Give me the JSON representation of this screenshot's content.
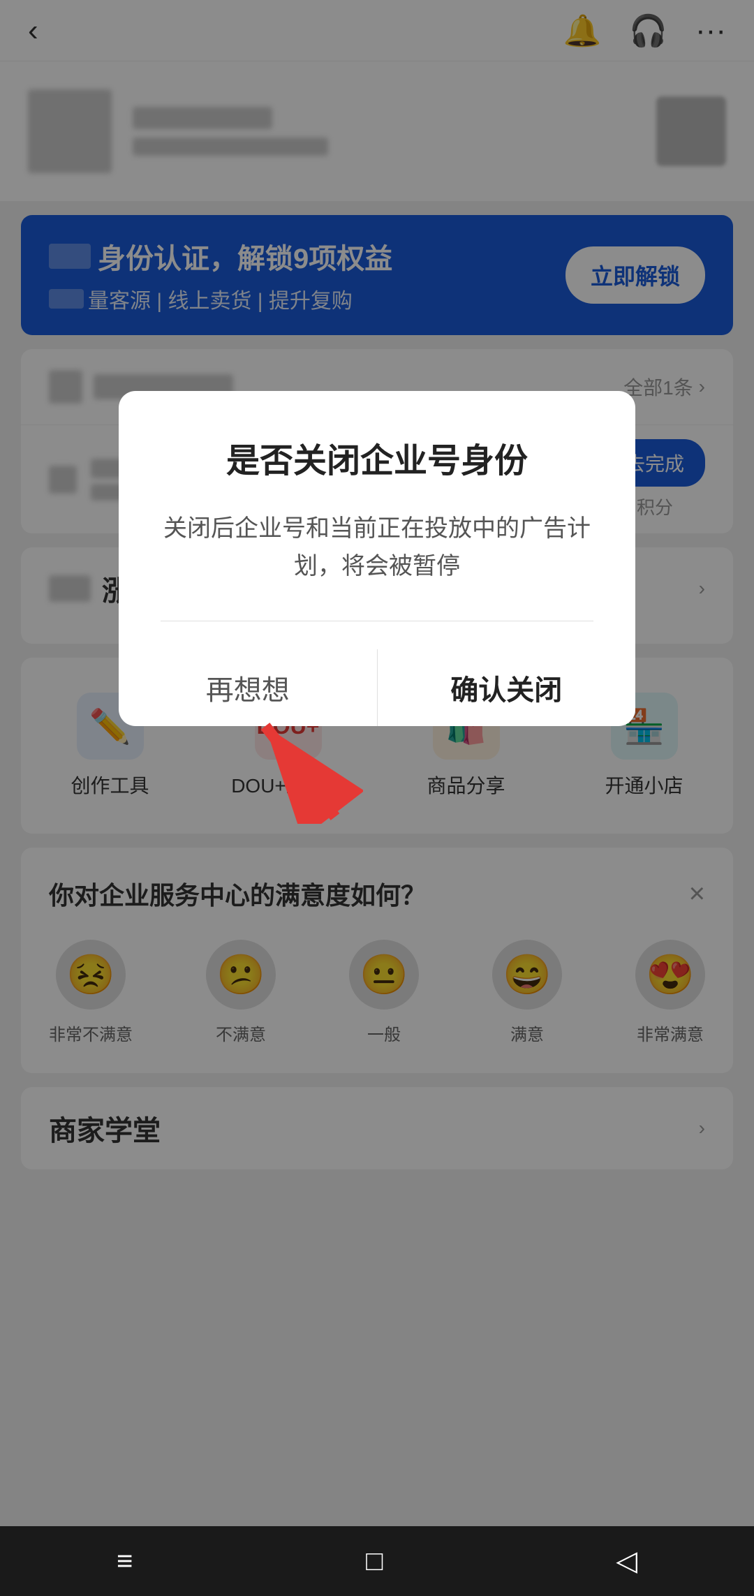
{
  "header": {
    "back_label": "‹",
    "bell_icon": "🔔",
    "headset_icon": "🎧",
    "more_icon": "···"
  },
  "banner": {
    "title": "身份认证，解锁9项权益",
    "subtitle": "量客源 | 线上卖货 | 提升复购",
    "unlock_button": "立即解锁"
  },
  "tasks": {
    "all_label": "全部1条",
    "chevron": "›",
    "complete_button": "去完成",
    "score_label": "积分"
  },
  "growth": {
    "title": "涨",
    "more_chevron": "›"
  },
  "tools": [
    {
      "label": "创作工具",
      "icon": "✏️",
      "color": "blue"
    },
    {
      "label": "DOU+上热门",
      "icon": "D+",
      "color": "red"
    },
    {
      "label": "商品分享",
      "icon": "🛍️",
      "color": "yellow"
    },
    {
      "label": "开通小店",
      "icon": "🏪",
      "color": "cyan"
    }
  ],
  "satisfaction": {
    "title": "你对企业服务中心的满意度如何？",
    "close_icon": "×",
    "emojis": [
      {
        "face": "😣",
        "label": "非常不满意"
      },
      {
        "face": "😕",
        "label": "不满意"
      },
      {
        "face": "😐",
        "label": "一般"
      },
      {
        "face": "😄",
        "label": "满意"
      },
      {
        "face": "😍",
        "label": "非常满意"
      }
    ]
  },
  "academy": {
    "title": "商家学堂",
    "more_chevron": "›"
  },
  "modal": {
    "title": "是否关闭企业号身份",
    "description": "关闭后企业号和当前正在投放中的广告计划，将会被暂停",
    "cancel_label": "再想想",
    "confirm_label": "确认关闭"
  },
  "bottom_nav": {
    "menu_icon": "≡",
    "home_icon": "□",
    "back_icon": "◁"
  }
}
